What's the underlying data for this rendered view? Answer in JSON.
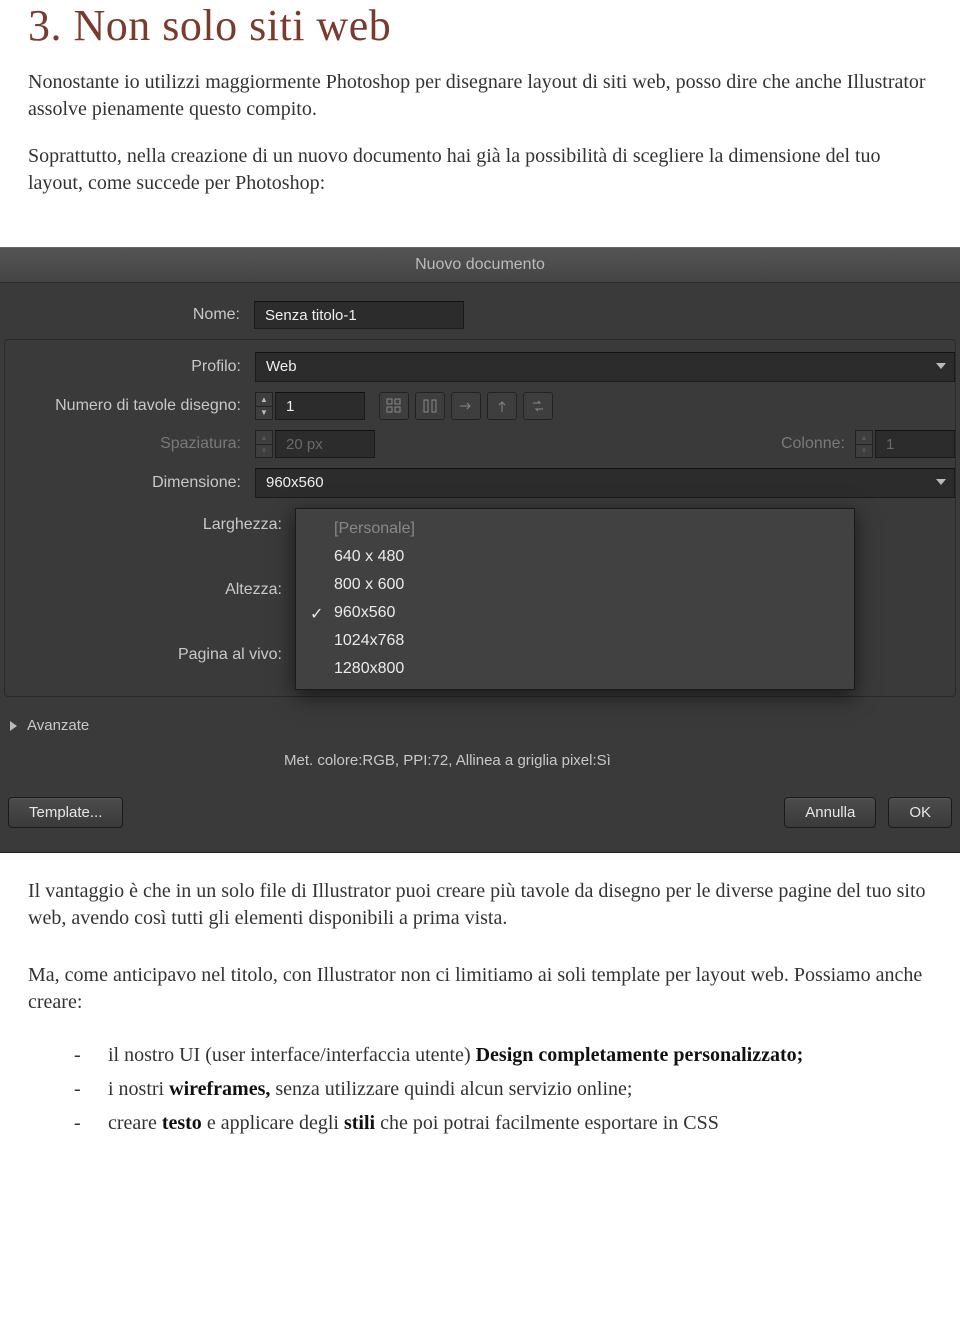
{
  "section": {
    "title": "3. Non solo siti web",
    "p1": "Nonostante io utilizzi maggiormente Photoshop per disegnare layout di siti web, posso dire che anche Illustrator assolve pienamente questo compito.",
    "p2": "Soprattutto, nella creazione di un nuovo documento hai già la possibilità di scegliere la dimensione del tuo layout, come succede per Photoshop:",
    "p3": "Il vantaggio è che in un solo file di Illustrator puoi creare più tavole da disegno per le diverse pagine del tuo sito web, avendo così tutti gli elementi disponibili a prima vista.",
    "p4": "Ma, come anticipavo nel titolo, con Illustrator non ci limitiamo ai soli template per layout web. Possiamo anche creare:"
  },
  "list": {
    "i1_a": "il nostro UI (user interface/interfaccia utente) ",
    "i1_b": "Design completamente personalizzato;",
    "i2_a": "i nostri ",
    "i2_b": "wireframes,",
    "i2_c": " senza utilizzare quindi alcun servizio online;",
    "i3_a": "creare ",
    "i3_b": "testo",
    "i3_c": " e applicare degli ",
    "i3_d": "stili",
    "i3_e": " che poi potrai facilmente esportare in CSS"
  },
  "dialog": {
    "title": "Nuovo documento",
    "labels": {
      "nome": "Nome:",
      "profilo": "Profilo:",
      "numTavole": "Numero di tavole disegno:",
      "spaziatura": "Spaziatura:",
      "colonne": "Colonne:",
      "dimensione": "Dimensione:",
      "larghezza": "Larghezza:",
      "altezza": "Altezza:",
      "paginaVivo": "Pagina al vivo:",
      "avanzate": "Avanzate"
    },
    "values": {
      "nome": "Senza titolo-1",
      "profilo": "Web",
      "numTavole": "1",
      "spaziatura": "20 px",
      "colonne": "1",
      "dimensioneSelected": "960x560"
    },
    "dropdown": {
      "opt0": "[Personale]",
      "opt1": "640 x 480",
      "opt2": "800 x 600",
      "opt3": "960x560",
      "opt4": "1024x768",
      "opt5": "1280x800"
    },
    "meta": "Met. colore:RGB, PPI:72, Allinea a griglia pixel:Sì",
    "buttons": {
      "template": "Template...",
      "annulla": "Annulla",
      "ok": "OK"
    }
  }
}
